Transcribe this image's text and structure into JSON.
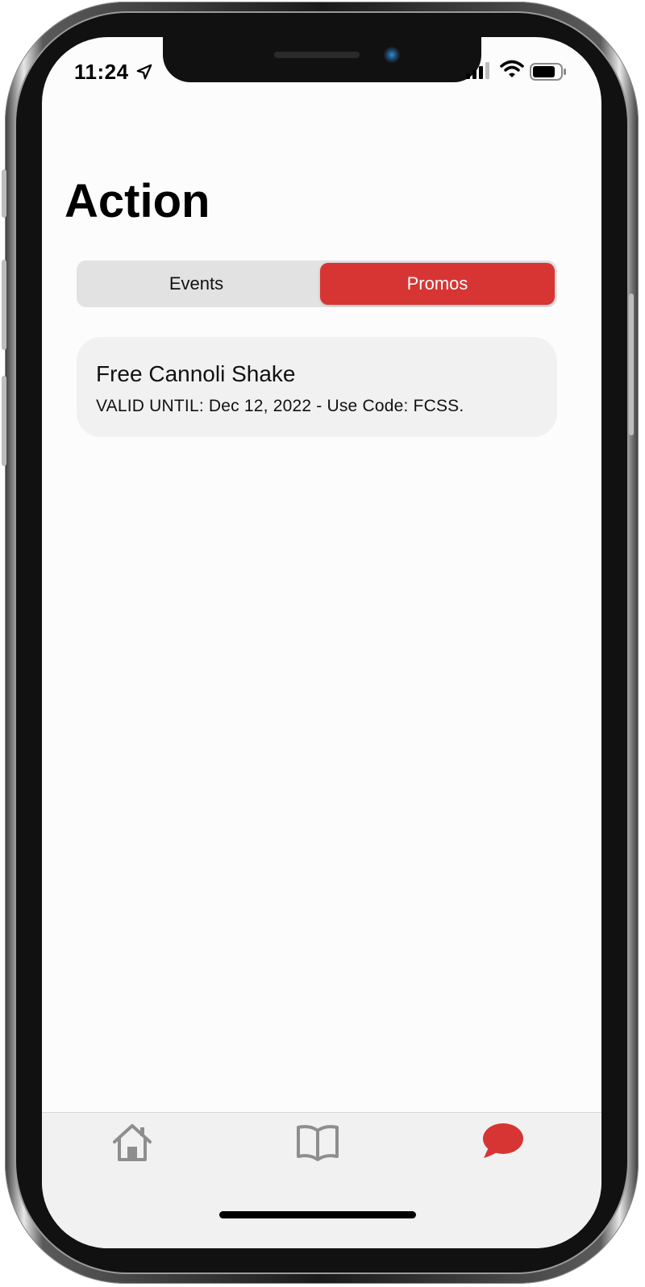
{
  "status_bar": {
    "time": "11:24",
    "location_icon": "location-arrow-icon",
    "signal_icon": "cellular-signal-icon",
    "wifi_icon": "wifi-icon",
    "battery_icon": "battery-icon"
  },
  "page": {
    "title": "Action"
  },
  "segmented_control": {
    "options": [
      {
        "label": "Events",
        "selected": false
      },
      {
        "label": "Promos",
        "selected": true
      }
    ]
  },
  "promos": [
    {
      "title": "Free Cannoli Shake",
      "detail": "VALID UNTIL: Dec 12, 2022 - Use Code: FCSS."
    }
  ],
  "tab_bar": {
    "items": [
      {
        "icon": "home-icon",
        "selected": false
      },
      {
        "icon": "book-icon",
        "selected": false
      },
      {
        "icon": "chat-bubble-icon",
        "selected": true
      }
    ]
  },
  "colors": {
    "accent": "#d63533",
    "inactive_icon": "#8e8e8e",
    "segment_background": "#e2e2e2",
    "card_background": "#f1f1f1"
  }
}
